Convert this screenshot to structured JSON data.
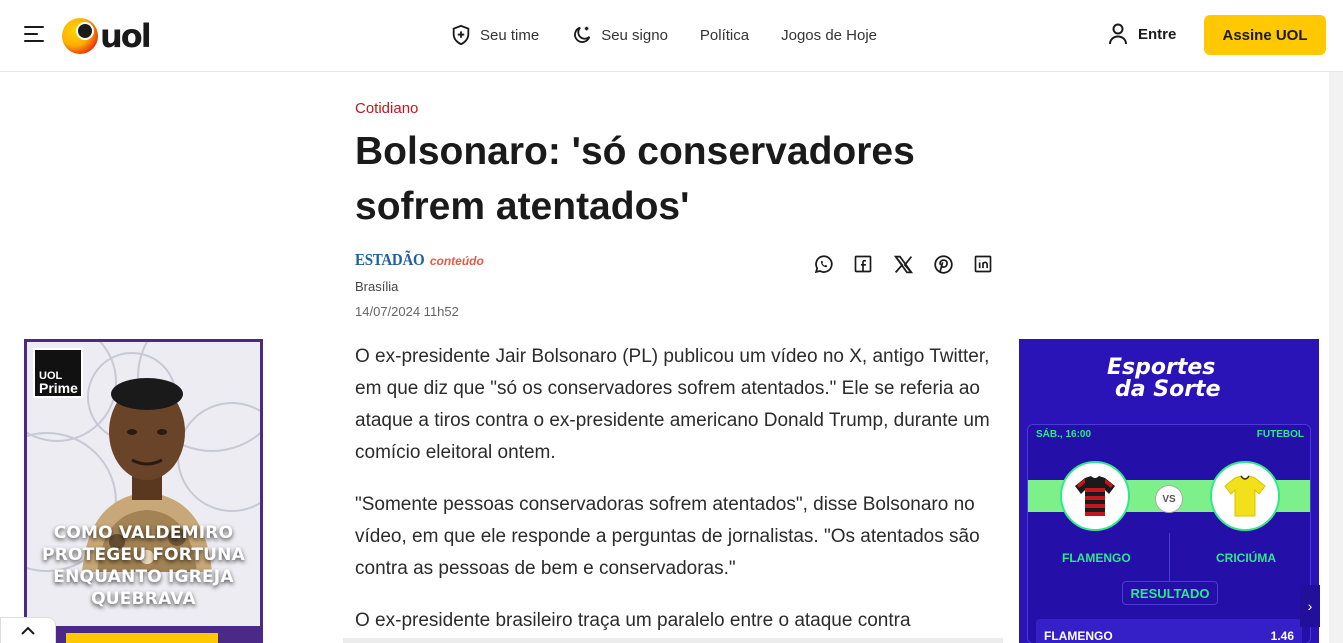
{
  "header": {
    "logo_text": "uol",
    "nav": [
      {
        "label": "Seu time",
        "icon": "shield-plus-icon"
      },
      {
        "label": "Seu signo",
        "icon": "moon-star-icon"
      },
      {
        "label": "Política"
      },
      {
        "label": "Jogos de Hoje"
      }
    ],
    "login_label": "Entre",
    "subscribe_label": "Assine UOL"
  },
  "article": {
    "category": "Cotidiano",
    "title": "Bolsonaro: 'só conservadores sofrem atentados'",
    "source_name": "ESTADÃO",
    "source_suffix": "conteúdo",
    "location": "Brasília",
    "date": "14/07/2024 11h52",
    "share": [
      "whatsapp-icon",
      "facebook-icon",
      "x-icon",
      "pinterest-icon",
      "linkedin-icon"
    ],
    "paragraphs": [
      "O ex-presidente Jair Bolsonaro (PL) publicou um vídeo no X, antigo Twitter, em que diz que \"só os conservadores sofrem atentados.\" Ele se referia ao ataque a tiros contra o ex-presidente americano Donald Trump, durante um comício eleitoral ontem.",
      "\"Somente pessoas conservadoras sofrem atentados\", disse Bolsonaro no vídeo, em que ele responde a perguntas de jornalistas. \"Os atentados são contra as pessoas de bem e conservadoras.\"",
      "O ex-presidente brasileiro traça um paralelo entre o ataque contra"
    ]
  },
  "ad_left": {
    "badge_top": "UOL",
    "badge_bottom": "Prime",
    "headline": "COMO VALDEMIRO PROTEGEU FORTUNA ENQUANTO IGREJA QUEBRAVA"
  },
  "ad_right": {
    "brand_line1": "Esportes",
    "brand_line2": "da Sorte",
    "match_time": "SÁB., 16:00",
    "sport": "FUTEBOL",
    "vs": "VS",
    "home_team": "FLAMENGO",
    "away_team": "CRICIÚMA",
    "result_label": "RESULTADO",
    "odds_team": "FLAMENGO",
    "odds_value": "1.46",
    "colors": {
      "bg": "#2a14b8",
      "accent": "#2ee88a"
    }
  }
}
